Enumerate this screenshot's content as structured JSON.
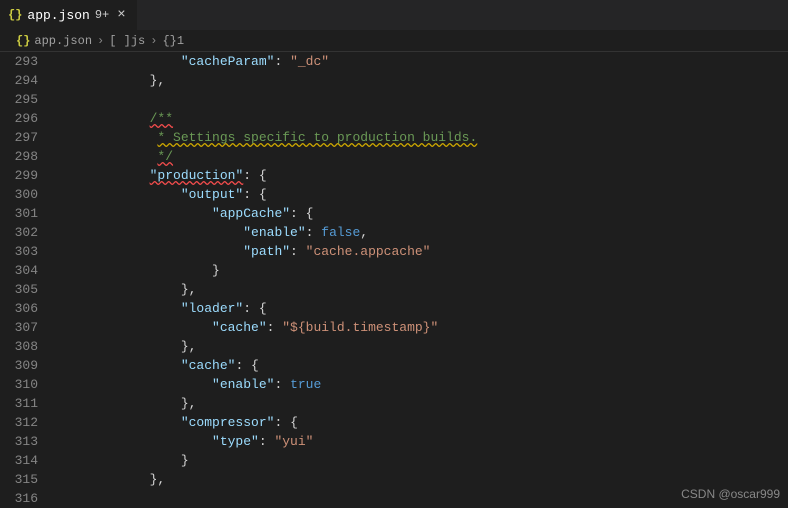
{
  "tab": {
    "icon": "{}",
    "name": "app.json",
    "dirty": "9+",
    "close": "×"
  },
  "breadcrumb": {
    "icon": "{}",
    "file": "app.json",
    "seg1_icon": "[ ]",
    "seg1": "js",
    "seg2_icon": "{}",
    "seg2": "1"
  },
  "gutter": {
    "start": 293,
    "end": 316
  },
  "code": {
    "l293": {
      "indent": "                ",
      "key": "\"cacheParam\"",
      "colon": ": ",
      "val": "\"_dc\""
    },
    "l294": {
      "indent": "            ",
      "text": "},"
    },
    "l295": {
      "indent": "",
      "text": ""
    },
    "l296": {
      "indent": "            ",
      "text": "/**"
    },
    "l297": {
      "indent": "             ",
      "text": "* Settings specific to production builds."
    },
    "l298": {
      "indent": "             ",
      "text": "*/"
    },
    "l299": {
      "indent": "            ",
      "key": "\"production\"",
      "colon": ": ",
      "brace": "{"
    },
    "l300": {
      "indent": "                ",
      "key": "\"output\"",
      "colon": ": ",
      "brace": "{"
    },
    "l301": {
      "indent": "                    ",
      "key": "\"appCache\"",
      "colon": ": ",
      "brace": "{"
    },
    "l302": {
      "indent": "                        ",
      "key": "\"enable\"",
      "colon": ": ",
      "val": "false",
      "comma": ","
    },
    "l303": {
      "indent": "                        ",
      "key": "\"path\"",
      "colon": ": ",
      "val": "\"cache.appcache\""
    },
    "l304": {
      "indent": "                    ",
      "text": "}"
    },
    "l305": {
      "indent": "                ",
      "text": "},"
    },
    "l306": {
      "indent": "                ",
      "key": "\"loader\"",
      "colon": ": ",
      "brace": "{"
    },
    "l307": {
      "indent": "                    ",
      "key": "\"cache\"",
      "colon": ": ",
      "val": "\"${build.timestamp}\""
    },
    "l308": {
      "indent": "                ",
      "text": "},"
    },
    "l309": {
      "indent": "                ",
      "key": "\"cache\"",
      "colon": ": ",
      "brace": "{"
    },
    "l310": {
      "indent": "                    ",
      "key": "\"enable\"",
      "colon": ": ",
      "val": "true"
    },
    "l311": {
      "indent": "                ",
      "text": "},"
    },
    "l312": {
      "indent": "                ",
      "key": "\"compressor\"",
      "colon": ": ",
      "brace": "{"
    },
    "l313": {
      "indent": "                    ",
      "key": "\"type\"",
      "colon": ": ",
      "val": "\"yui\""
    },
    "l314": {
      "indent": "                ",
      "text": "}"
    },
    "l315": {
      "indent": "            ",
      "text": "},"
    },
    "l316": {
      "indent": "",
      "text": ""
    }
  },
  "watermark": "CSDN @oscar999"
}
